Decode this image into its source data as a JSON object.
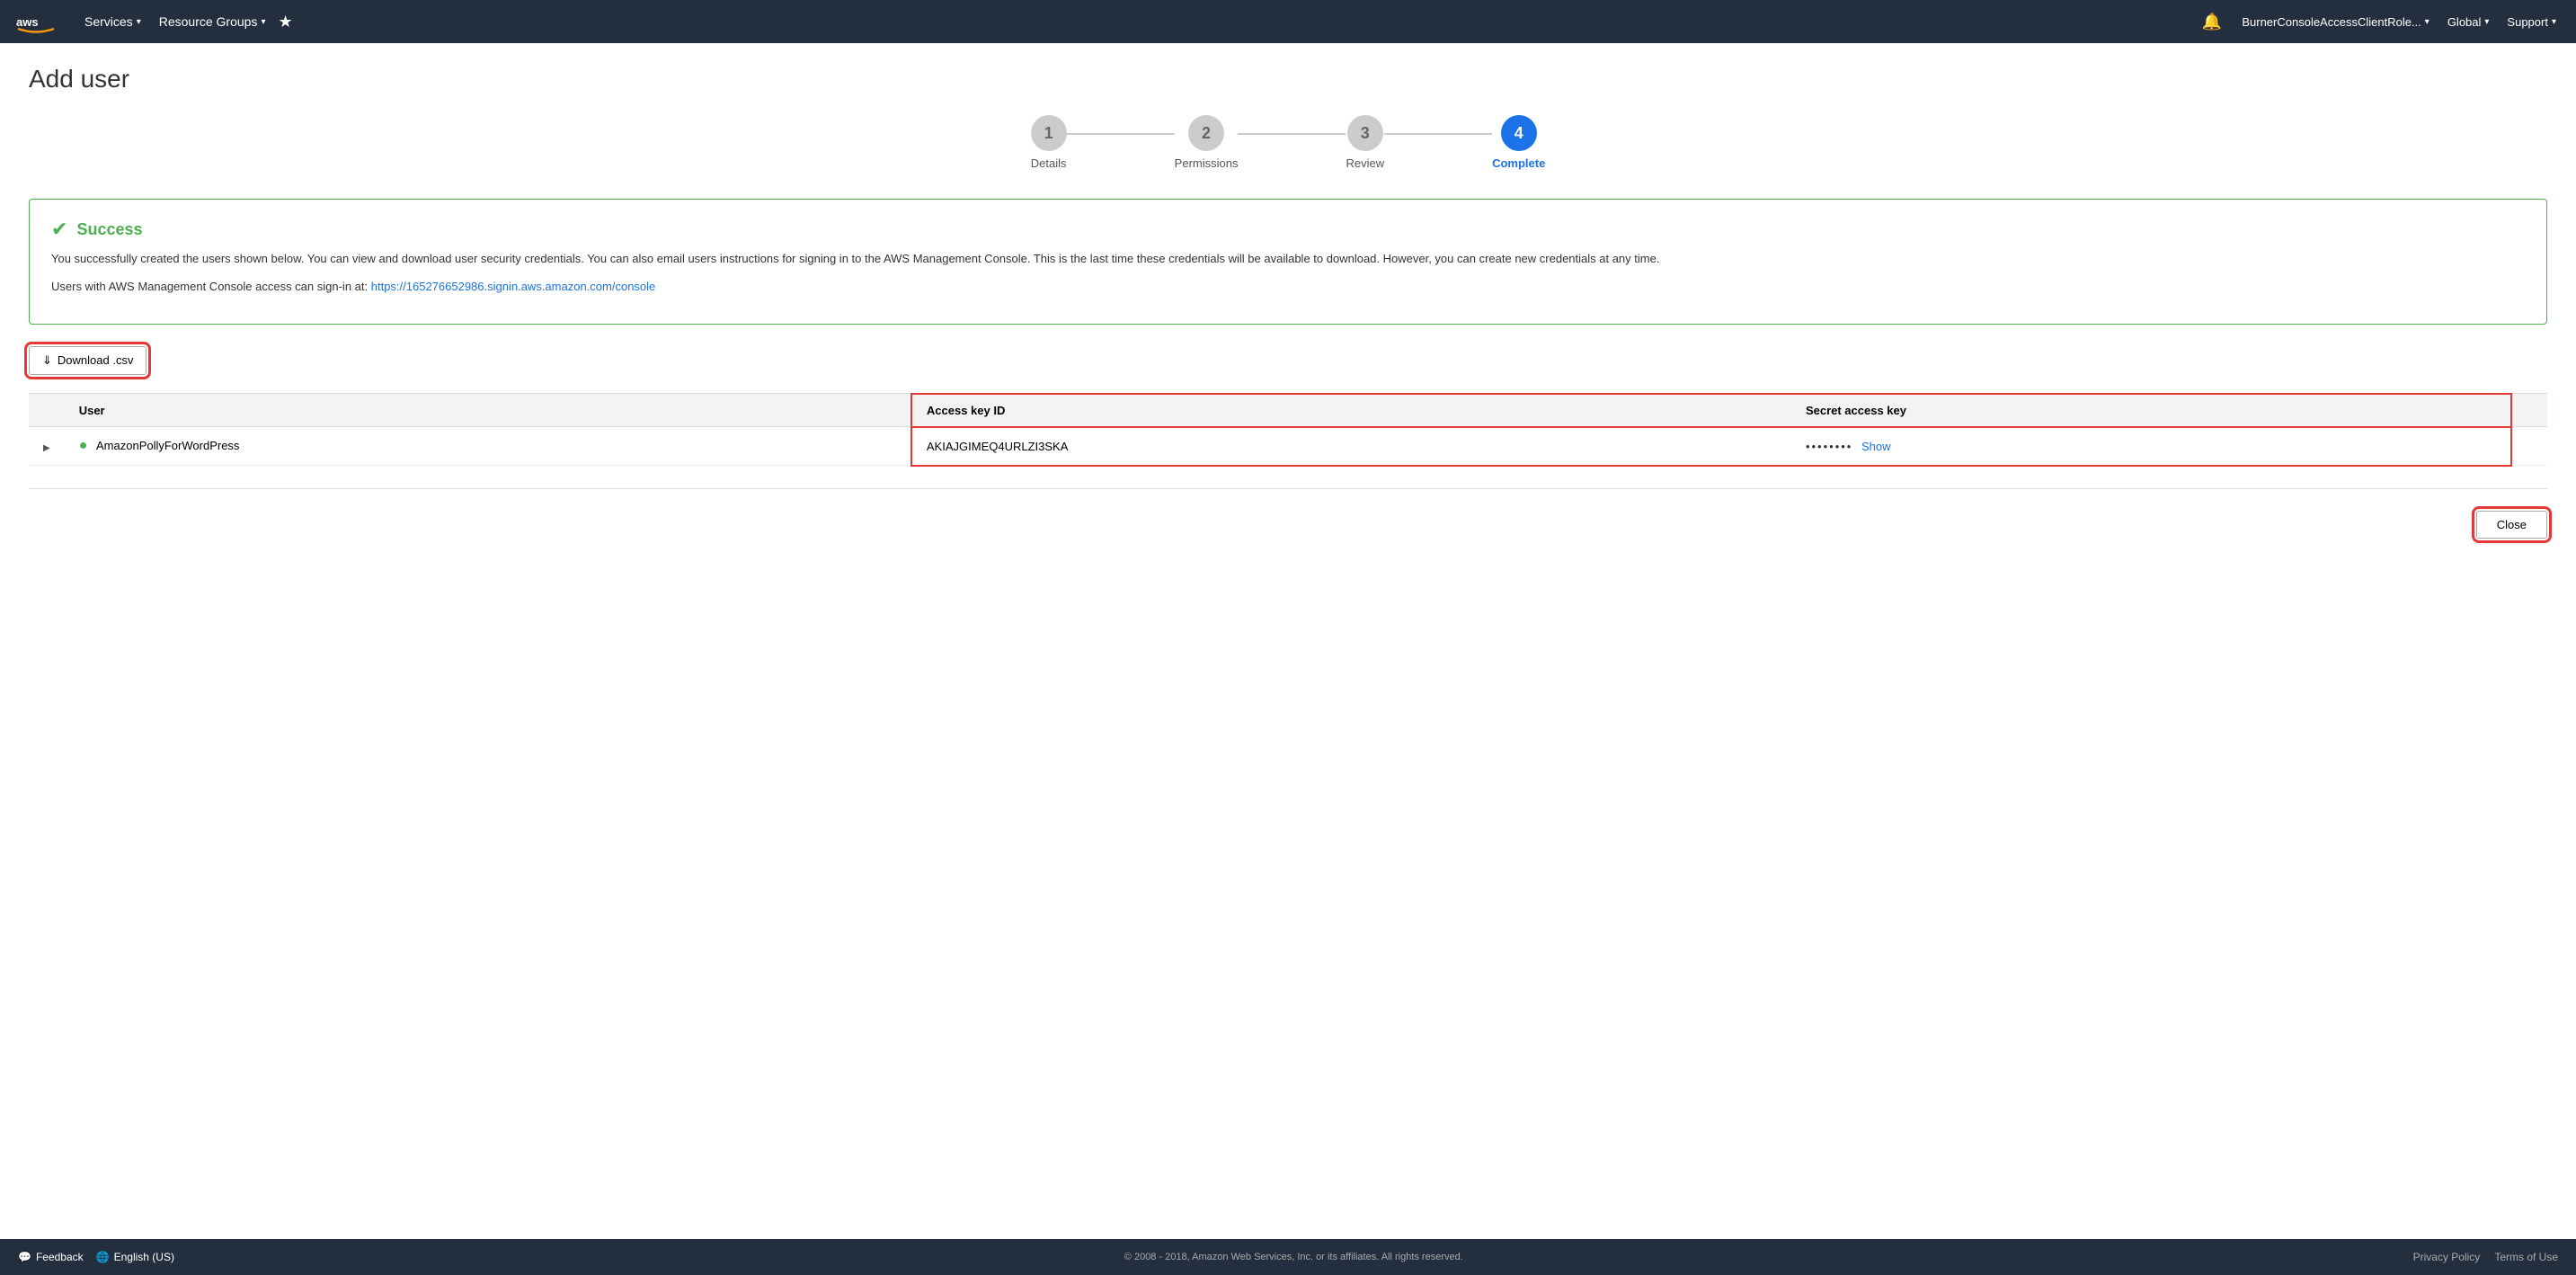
{
  "navbar": {
    "logo_alt": "AWS",
    "services_label": "Services",
    "resource_groups_label": "Resource Groups",
    "bell_title": "Notifications",
    "account_label": "BurnerConsoleAccessClientRole...",
    "region_label": "Global",
    "support_label": "Support"
  },
  "page": {
    "title": "Add user"
  },
  "stepper": {
    "steps": [
      {
        "number": "1",
        "label": "Details",
        "state": "inactive"
      },
      {
        "number": "2",
        "label": "Permissions",
        "state": "inactive"
      },
      {
        "number": "3",
        "label": "Review",
        "state": "inactive"
      },
      {
        "number": "4",
        "label": "Complete",
        "state": "active"
      }
    ]
  },
  "success": {
    "title": "Success",
    "body": "You successfully created the users shown below. You can view and download user security credentials. You can also email users instructions for signing in to the AWS Management Console. This is the last time these credentials will be available to download. However, you can create new credentials at any time.",
    "console_prefix": "Users with AWS Management Console access can sign-in at: ",
    "console_url": "https://165276652986.signin.aws.amazon.com/console"
  },
  "download_button": "Download .csv",
  "table": {
    "col_user": "User",
    "col_access_key_id": "Access key ID",
    "col_secret_access_key": "Secret access key",
    "rows": [
      {
        "user": "AmazonPollyForWordPress",
        "access_key_id": "AKIAJGIMEQ4URLZI3SKA",
        "secret_access_key": "••••••••",
        "show_label": "Show"
      }
    ]
  },
  "close_button": "Close",
  "footer": {
    "feedback_label": "Feedback",
    "locale_label": "English (US)",
    "copyright": "© 2008 - 2018, Amazon Web Services, Inc. or its affiliates. All rights reserved.",
    "privacy_policy": "Privacy Policy",
    "terms_of_use": "Terms of Use"
  }
}
